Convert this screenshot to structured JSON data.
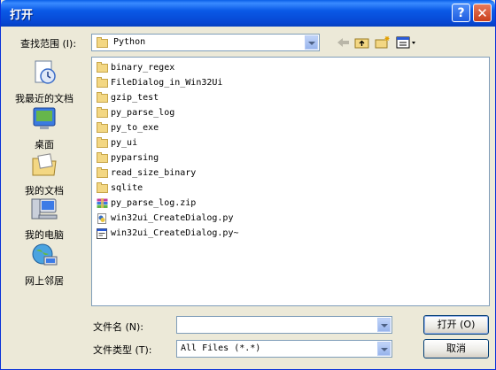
{
  "window": {
    "title": "打开",
    "help_glyph": "?",
    "close_glyph": "✕"
  },
  "lookin": {
    "label": "查找范围 (I):",
    "value": "Python"
  },
  "toolbar": {
    "back_icon": "back-arrow-icon",
    "up_icon": "up-folder-icon",
    "new_folder_icon": "new-folder-icon",
    "views_icon": "views-menu-icon"
  },
  "places": [
    {
      "label": "我最近的文档",
      "icon": "recent-documents-icon"
    },
    {
      "label": "桌面",
      "icon": "desktop-icon"
    },
    {
      "label": "我的文档",
      "icon": "my-documents-icon"
    },
    {
      "label": "我的电脑",
      "icon": "my-computer-icon"
    },
    {
      "label": "网上邻居",
      "icon": "network-places-icon"
    }
  ],
  "files": [
    {
      "name": "binary_regex",
      "type": "folder"
    },
    {
      "name": "FileDialog_in_Win32Ui",
      "type": "folder"
    },
    {
      "name": "gzip_test",
      "type": "folder"
    },
    {
      "name": "py_parse_log",
      "type": "folder"
    },
    {
      "name": "py_to_exe",
      "type": "folder"
    },
    {
      "name": "py_ui",
      "type": "folder"
    },
    {
      "name": "pyparsing",
      "type": "folder"
    },
    {
      "name": "read_size_binary",
      "type": "folder"
    },
    {
      "name": "sqlite",
      "type": "folder"
    },
    {
      "name": "py_parse_log.zip",
      "type": "zip"
    },
    {
      "name": "win32ui_CreateDialog.py",
      "type": "py"
    },
    {
      "name": "win32ui_CreateDialog.py~",
      "type": "file"
    }
  ],
  "filename": {
    "label": "文件名 (N):",
    "value": ""
  },
  "filetype": {
    "label": "文件类型 (T):",
    "value": "All Files (*.*)"
  },
  "buttons": {
    "open": "打开 (O)",
    "cancel": "取消"
  },
  "colors": {
    "titlebar": "#0a59e6",
    "dialog_bg": "#ece9d8",
    "folder": "#f3d783"
  }
}
